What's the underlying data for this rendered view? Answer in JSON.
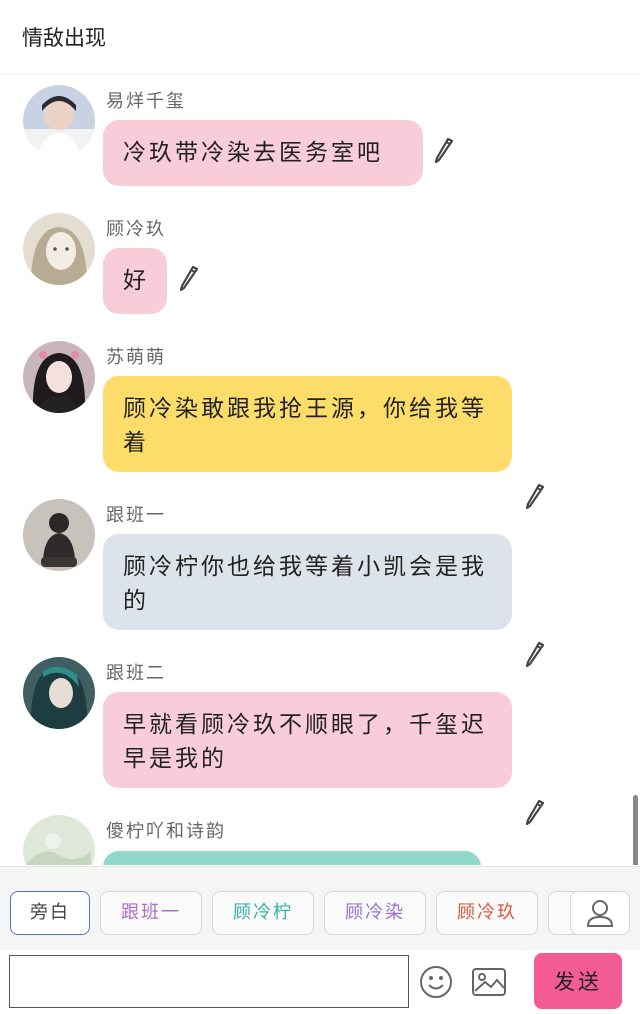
{
  "header": {
    "title": "情敌出现"
  },
  "messages": [
    {
      "name": "易烊千玺",
      "text": "冷玖带冷染去医务室吧",
      "bubble_color": "#f8ccd9",
      "avatar_color": "#b8c6d8"
    },
    {
      "name": "顾冷玖",
      "text": "好",
      "bubble_color": "#f8ccd9",
      "avatar_color": "#d8d2c0"
    },
    {
      "name": "苏萌萌",
      "text": "顾冷染敢跟我抢王源，你给我等着",
      "bubble_color": "#fddd6a",
      "avatar_color": "#3a3236"
    },
    {
      "name": "跟班一",
      "text": "顾冷柠你也给我等着小凯会是我的",
      "bubble_color": "#dde3ea",
      "avatar_color": "#4a4848"
    },
    {
      "name": "跟班二",
      "text": "早就看顾冷玖不顺眼了，千玺迟早是我的",
      "bubble_color": "#f8ccd9",
      "avatar_color": "#2f6e6a"
    },
    {
      "name": "傻柠吖和诗韵",
      "text": "",
      "bubble_color": "#8fd9cb",
      "avatar_color": "#d9e4d0"
    }
  ],
  "chips": [
    {
      "label": "旁白",
      "color": "#444444",
      "active": true
    },
    {
      "label": "跟班一",
      "color": "#b06ad0",
      "active": false
    },
    {
      "label": "顾冷柠",
      "color": "#2fb3a8",
      "active": false
    },
    {
      "label": "顾冷染",
      "color": "#9a6fcf",
      "active": false
    },
    {
      "label": "顾冷玖",
      "color": "#d9583a",
      "active": false
    }
  ],
  "input": {
    "placeholder": "",
    "send_label": "发送"
  },
  "icons": {
    "edit": "pencil-icon",
    "user": "user-icon",
    "emoji": "smiley-icon",
    "image": "image-icon"
  }
}
